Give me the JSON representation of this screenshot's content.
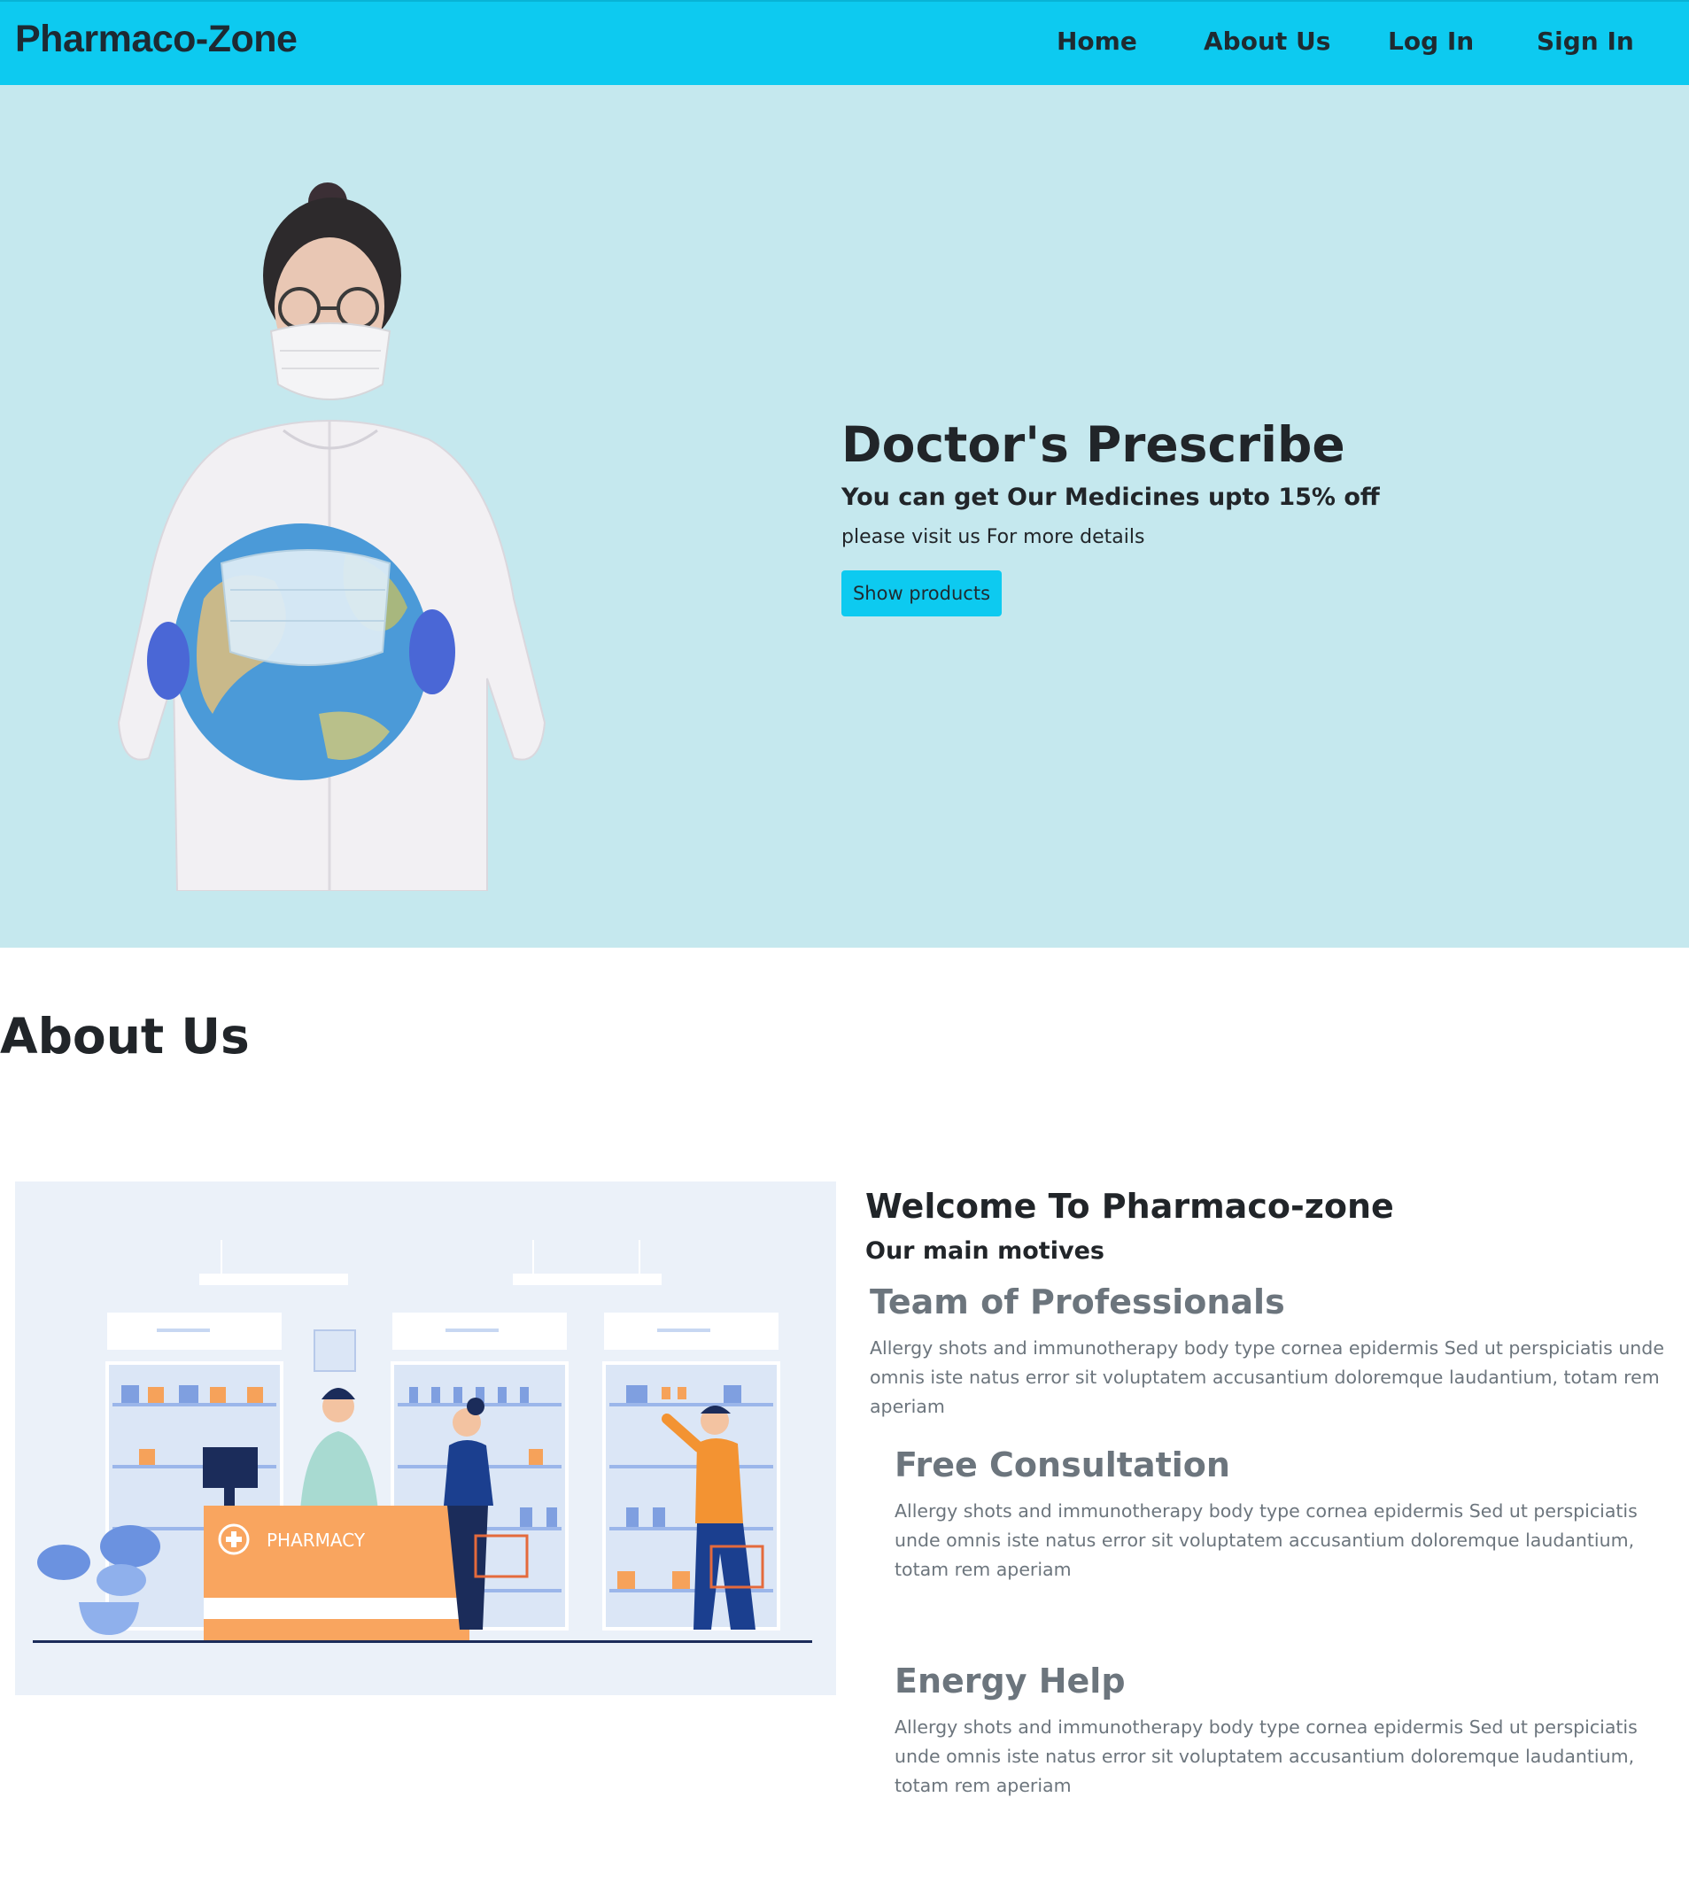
{
  "navbar": {
    "brand": "Pharmaco-Zone",
    "links": [
      "Home",
      "About Us",
      "Log In",
      "Sign In"
    ],
    "background_color": "#0dcaf0"
  },
  "hero": {
    "title": "Doctor's Prescribe",
    "subtitle": "You can get Our Medicines upto 15% off",
    "text": "please visit us For more details",
    "button_label": "Show products",
    "background_color": "#c5e8ee",
    "image": "doctor-holding-masked-globe"
  },
  "about": {
    "heading": "About Us",
    "image": "pharmacy-store-illustration",
    "illustration_sign": "PHARMACY",
    "welcome_title": "Welcome To Pharmaco-zone",
    "motives_subtitle": "Our main motives",
    "features": [
      {
        "title": "Team of Professionals",
        "text": "Allergy shots and immunotherapy body type cornea epidermis Sed ut perspiciatis unde omnis iste natus error sit voluptatem accusantium doloremque laudantium, totam rem aperiam"
      },
      {
        "title": "Free Consultation",
        "text": "Allergy shots and immunotherapy body type cornea epidermis Sed ut perspiciatis unde omnis iste natus error sit voluptatem accusantium doloremque laudantium, totam rem aperiam"
      },
      {
        "title": "Energy Help",
        "text": "Allergy shots and immunotherapy body type cornea epidermis Sed ut perspiciatis unde omnis iste natus error sit voluptatem accusantium doloremque laudantium, totam rem aperiam"
      }
    ]
  }
}
